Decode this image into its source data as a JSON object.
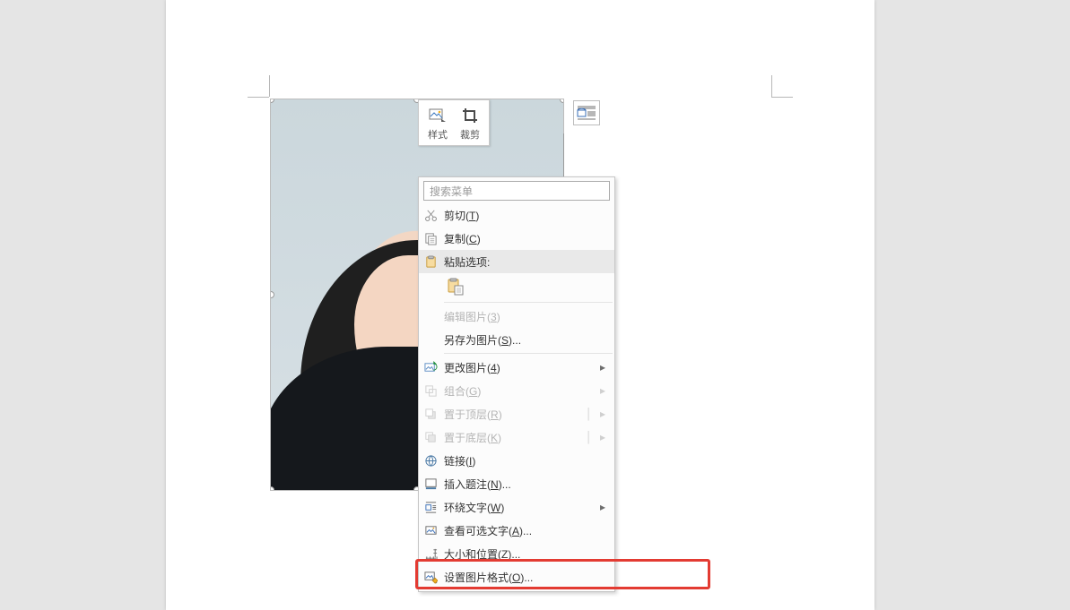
{
  "mini_toolbar": {
    "style_label": "样式",
    "crop_label": "裁剪"
  },
  "context_menu": {
    "search_placeholder": "搜索菜单",
    "cut": "剪切",
    "cut_key": "T",
    "copy": "复制",
    "copy_key": "C",
    "paste_options": "粘贴选项:",
    "edit_picture": "编辑图片",
    "edit_picture_key": "3",
    "save_as_picture": "另存为图片",
    "save_as_picture_key": "S",
    "save_as_picture_suffix": "...",
    "change_picture": "更改图片",
    "change_picture_key": "4",
    "group": "组合",
    "group_key": "G",
    "bring_to_front": "置于顶层",
    "bring_to_front_key": "R",
    "send_to_back": "置于底层",
    "send_to_back_key": "K",
    "link": "链接",
    "link_key": "I",
    "insert_caption": "插入题注",
    "insert_caption_key": "N",
    "insert_caption_suffix": "...",
    "wrap_text": "环绕文字",
    "wrap_text_key": "W",
    "alt_text": "查看可选文字",
    "alt_text_key": "A",
    "alt_text_suffix": "...",
    "size_position": "大小和位置",
    "size_position_key": "Z",
    "size_position_suffix": "...",
    "format_picture": "设置图片格式",
    "format_picture_key": "O",
    "format_picture_suffix": "..."
  }
}
